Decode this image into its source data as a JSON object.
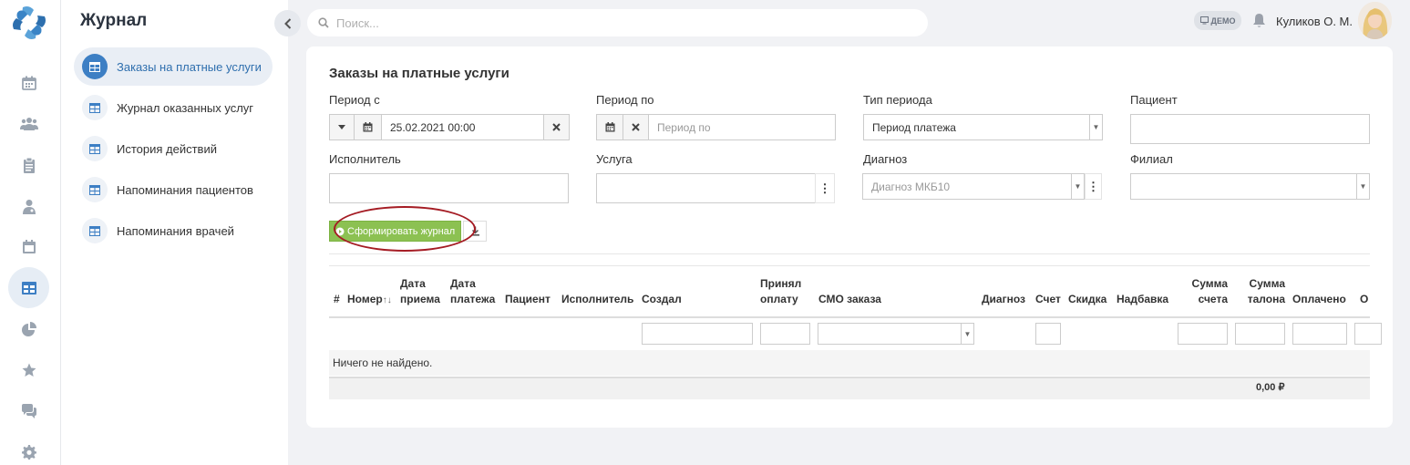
{
  "app": {
    "section_title": "Журнал"
  },
  "icon_rail": [
    {
      "name": "calendar-icon"
    },
    {
      "name": "users-icon"
    },
    {
      "name": "clipboard-icon"
    },
    {
      "name": "doctor-icon"
    },
    {
      "name": "schedule-icon"
    },
    {
      "name": "table-icon",
      "active": true
    },
    {
      "name": "pie-chart-icon"
    },
    {
      "name": "star-icon"
    },
    {
      "name": "chat-icon"
    },
    {
      "name": "gear-icon"
    }
  ],
  "subnav": {
    "items": [
      {
        "label": "Заказы на платные услуги",
        "active": true
      },
      {
        "label": "Журнал оказанных услуг"
      },
      {
        "label": "История действий"
      },
      {
        "label": "Напоминания пациентов"
      },
      {
        "label": "Напоминания врачей"
      }
    ]
  },
  "header": {
    "search_placeholder": "Поиск...",
    "demo_badge": "ДЕМО",
    "user_name": "Куликов О. М."
  },
  "form": {
    "title": "Заказы на платные услуги",
    "period_from": {
      "label": "Период с",
      "value": "25.02.2021 00:00"
    },
    "period_to": {
      "label": "Период по",
      "placeholder": "Период по"
    },
    "period_type": {
      "label": "Тип периода",
      "value": "Период платежа"
    },
    "patient": {
      "label": "Пациент",
      "value": ""
    },
    "executor": {
      "label": "Исполнитель",
      "value": ""
    },
    "service": {
      "label": "Услуга",
      "value": ""
    },
    "diagnosis": {
      "label": "Диагноз",
      "placeholder": "Диагноз МКБ10"
    },
    "branch": {
      "label": "Филиал",
      "value": ""
    },
    "generate_button": "Сформировать журнал"
  },
  "table": {
    "columns": {
      "num": "#",
      "number": "Номер",
      "admission_date_1": "Дата",
      "admission_date_2": "приема",
      "payment_date_1": "Дата",
      "payment_date_2": "платежа",
      "patient": "Пациент",
      "executor": "Исполнитель",
      "created": "Создал",
      "accepted_1": "Принял",
      "accepted_2": "оплату",
      "smo": "СМО заказа",
      "diagnosis": "Диагноз",
      "invoice": "Счет",
      "discount": "Скидка",
      "markup": "Надбавка",
      "invoice_sum_1": "Сумма",
      "invoice_sum_2": "счета",
      "coupon_sum_1": "Сумма",
      "coupon_sum_2": "талона",
      "paid": "Оплачено",
      "cut": "О"
    },
    "empty_text": "Ничего не найдено.",
    "total": "0,00 ₽"
  }
}
